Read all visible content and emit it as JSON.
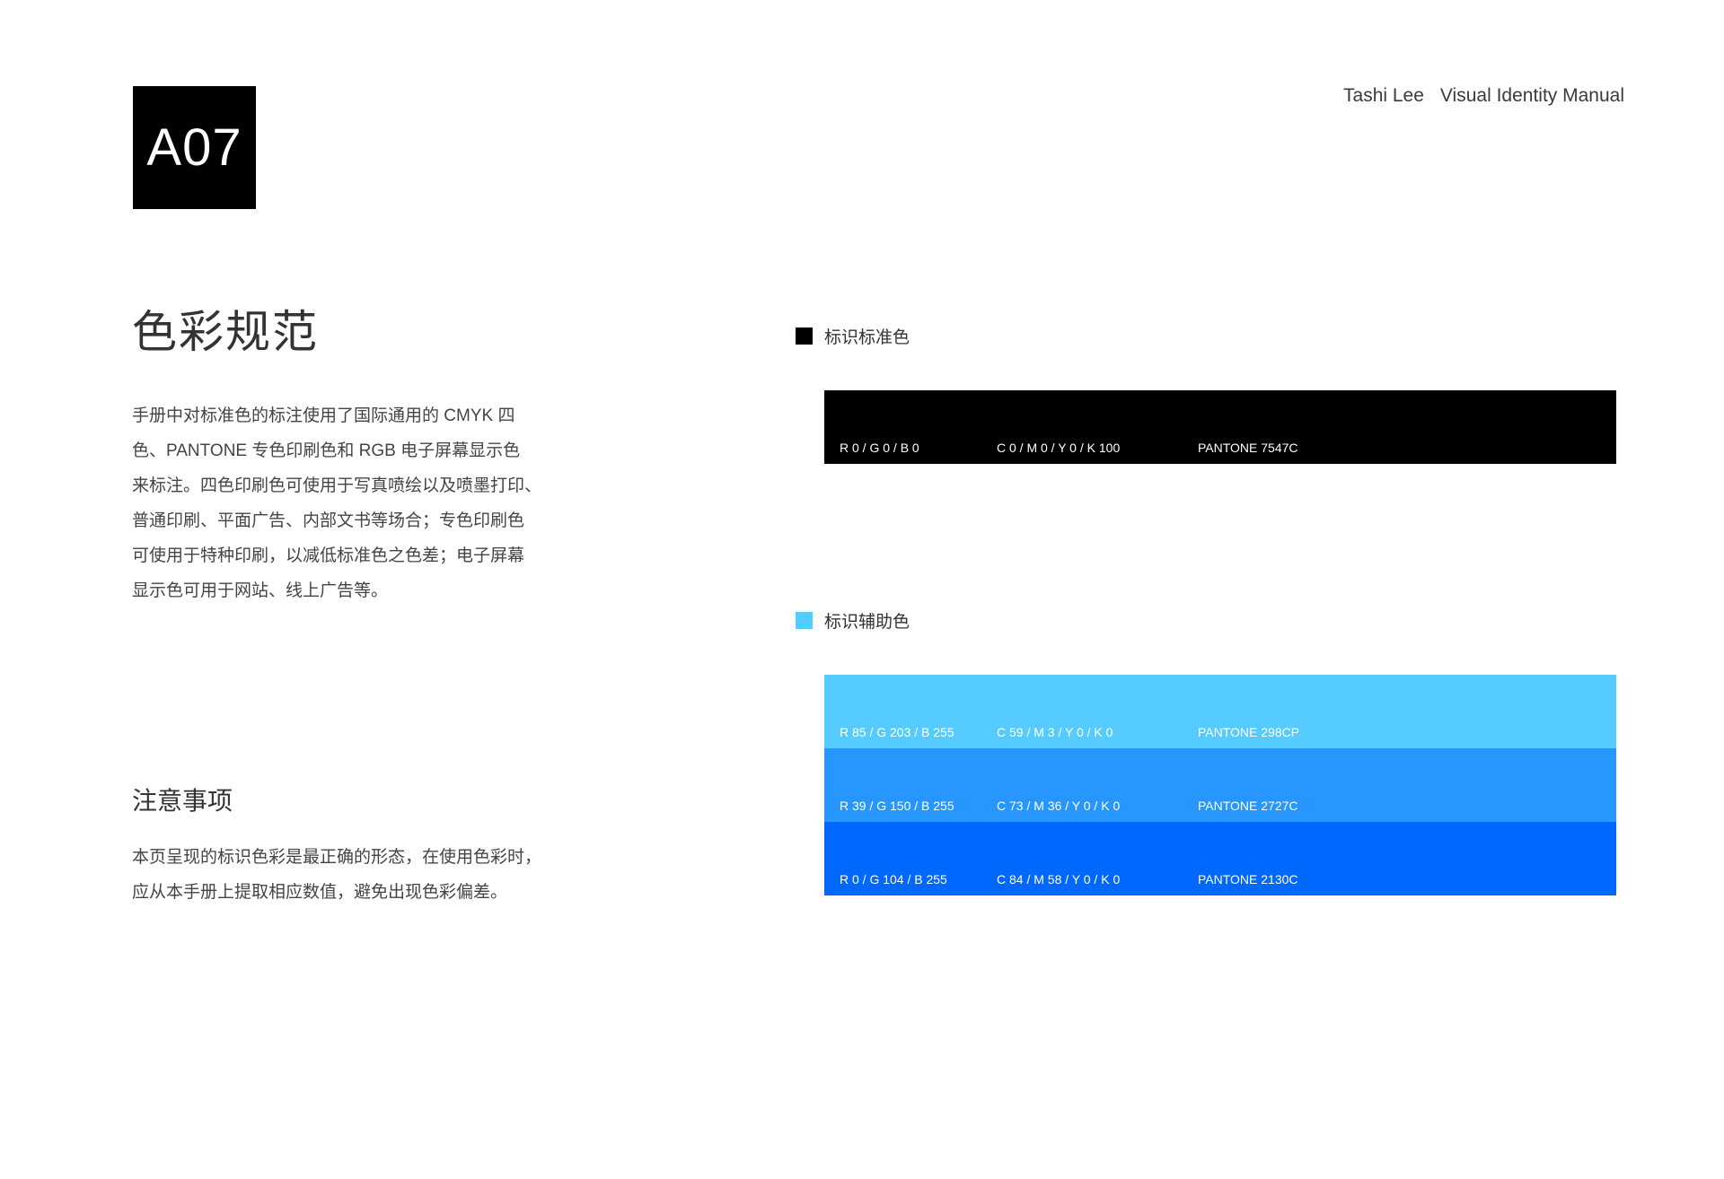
{
  "header": {
    "page_code": "A07",
    "brand_name": "Tashi Lee",
    "manual_title": "Visual Identity Manual"
  },
  "main": {
    "title": "色彩规范",
    "intro_lines": [
      "手册中对标准色的标注使用了国际通用的 CMYK 四",
      "色、PANTONE 专色印刷色和 RGB 电子屏幕显示色",
      "来标注。四色印刷色可使用于写真喷绘以及喷墨打印、",
      "普通印刷、平面广告、内部文书等场合；专色印刷色",
      "可使用于特种印刷，以减低标准色之色差；电子屏幕",
      "显示色可用于网站、线上广告等。"
    ],
    "notes_title": "注意事项",
    "notes_lines": [
      "本页呈现的标识色彩是最正确的形态，在使用色彩时，",
      "应从本手册上提取相应数值，避免出现色彩偏差。"
    ]
  },
  "standard": {
    "label": "标识标准色",
    "marker_color": "#000000",
    "swatches": [
      {
        "color": "#000000",
        "rgb": "R 0 / G 0 / B 0",
        "cmyk": "C 0 / M 0 / Y 0 / K 100",
        "pantone": "PANTONE 7547C"
      }
    ]
  },
  "auxiliary": {
    "label": "标识辅助色",
    "marker_color": "#55CBFF",
    "swatches": [
      {
        "color": "#55CBFF",
        "rgb": "R 85 / G 203 / B 255",
        "cmyk": "C 59 / M 3 / Y 0 / K 0",
        "pantone": "PANTONE 298CP"
      },
      {
        "color": "#2796FF",
        "rgb": "R 39 / G 150 / B 255",
        "cmyk": "C 73 / M 36 / Y 0 / K 0",
        "pantone": "PANTONE 2727C"
      },
      {
        "color": "#0068FF",
        "rgb": "R 0 / G 104 / B 255",
        "cmyk": "C 84 / M 58 / Y 0 / K 0",
        "pantone": "PANTONE 2130C"
      }
    ]
  }
}
